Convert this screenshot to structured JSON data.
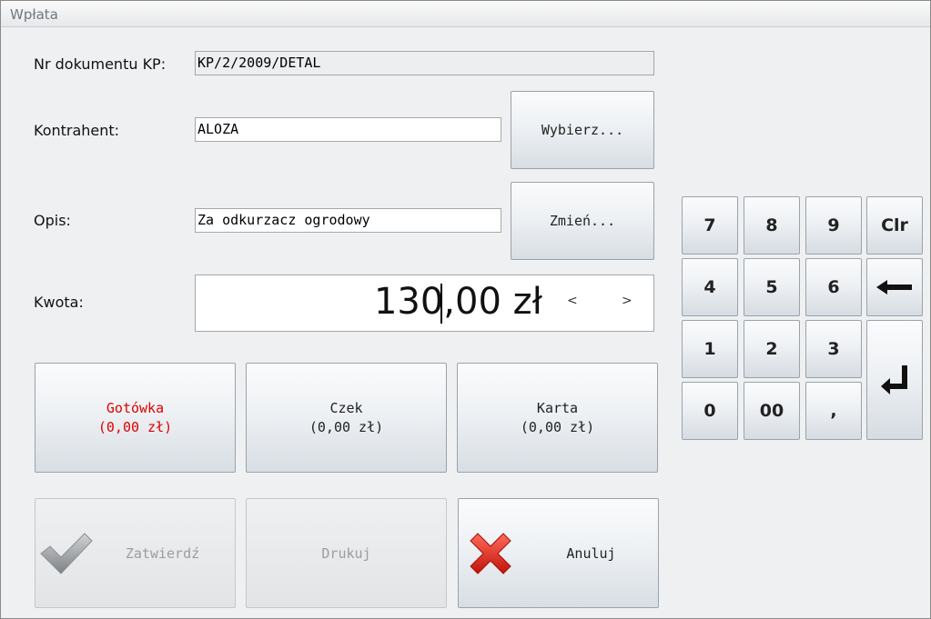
{
  "window": {
    "title": "Wpłata"
  },
  "form": {
    "doc_label": "Nr dokumentu KP:",
    "doc_value": "KP/2/2009/DETAL",
    "contractor_label": "Kontrahent:",
    "contractor_value": "ALOZA",
    "desc_label": "Opis:",
    "desc_value": "Za odkurzacz ogrodowy",
    "amount_label": "Kwota:"
  },
  "buttons": {
    "select": "Wybierz...",
    "change": "Zmień..."
  },
  "amount": {
    "value": "130,00 zł",
    "prev": "<",
    "next": ">"
  },
  "payments": [
    {
      "name": "Gotówka",
      "amount": "(0,00 zł)",
      "color": "#e00000"
    },
    {
      "name": "Czek",
      "amount": "(0,00 zł)"
    },
    {
      "name": "Karta",
      "amount": "(0,00 zł)"
    }
  ],
  "actions": {
    "confirm": "Zatwierdź",
    "print": "Drukuj",
    "cancel": "Anuluj"
  },
  "keypad": {
    "k7": "7",
    "k8": "8",
    "k9": "9",
    "clr": "Clr",
    "k4": "4",
    "k5": "5",
    "k6": "6",
    "k1": "1",
    "k2": "2",
    "k3": "3",
    "k0": "0",
    "k00": "00",
    "comma": ","
  },
  "icons": {
    "confirm": "checkmark-icon",
    "cancel": "cross-icon",
    "backspace": "arrow-left-icon",
    "enter": "enter-icon"
  }
}
